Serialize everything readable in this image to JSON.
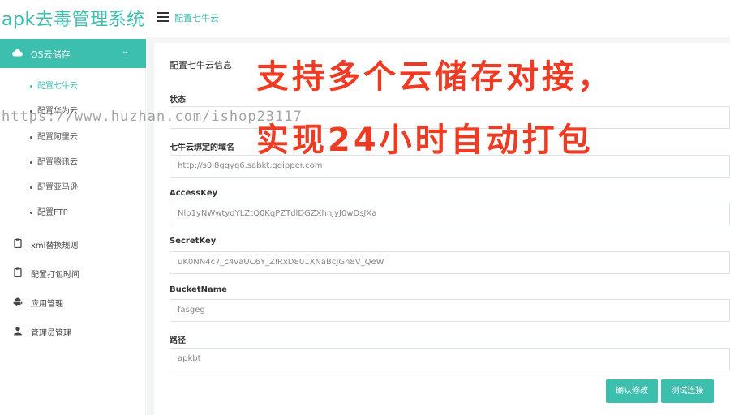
{
  "header": {
    "brand": "apk去毒管理系统",
    "breadcrumb": "配置七牛云"
  },
  "sidebar": {
    "group": {
      "label": "OS云储存",
      "chevron": "⌄"
    },
    "sub_items": [
      {
        "label": "配置七牛云",
        "active": true
      },
      {
        "label": "配置华为云"
      },
      {
        "label": "配置阿里云"
      },
      {
        "label": "配置腾讯云"
      },
      {
        "label": "配置亚马逊"
      },
      {
        "label": "配置FTP"
      }
    ],
    "items": [
      {
        "label": "xml替换规则",
        "icon": "clipboard-icon"
      },
      {
        "label": "配置打包时间",
        "icon": "clipboard-icon"
      },
      {
        "label": "应用管理",
        "icon": "android-icon"
      },
      {
        "label": "管理员管理",
        "icon": "user-icon"
      }
    ]
  },
  "form": {
    "title": "配置七牛云信息",
    "fields": [
      {
        "label": "状态",
        "value": ""
      },
      {
        "label": "七牛云绑定的域名",
        "value": "http://s0i8gqyq6.sabkt.gdipper.com"
      },
      {
        "label": "AccessKey",
        "value": "Nlp1yNWwtydYLZtQ0KqPZTdlDGZXhnJyJ0wDsJXa"
      },
      {
        "label": "SecretKey",
        "value": "uK0NN4c7_c4vaUC6Y_ZIRxD801XNaBcJGn8V_QeW"
      },
      {
        "label": "BucketName",
        "value": "fasgeg"
      },
      {
        "label": "路径",
        "value": "apkbt"
      }
    ],
    "confirm_label": "确认修改",
    "test_label": "测试连接"
  },
  "overlay": {
    "line1": "支持多个云储存对接，",
    "line2": "实现24小时自动打包",
    "watermark": "https://www.huzhan.com/ishop23117"
  },
  "colors": {
    "accent": "#3dbfae",
    "promo": "#ee3b24"
  }
}
